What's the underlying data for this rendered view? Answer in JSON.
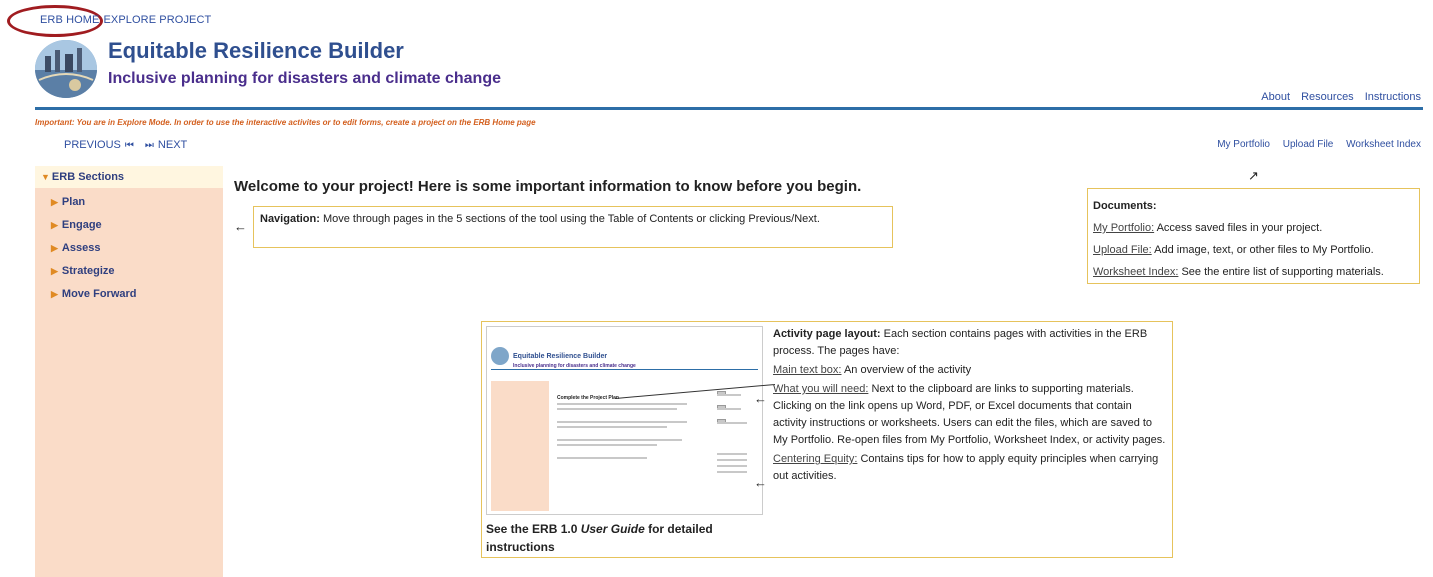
{
  "topnav": {
    "home": "ERB HOME",
    "explore": "EXPLORE PROJECT"
  },
  "header": {
    "title": "Equitable Resilience Builder",
    "subtitle": "Inclusive planning for disasters and climate change",
    "links": [
      "About",
      "Resources",
      "Instructions"
    ]
  },
  "warning": "Important: You are in Explore Mode. In order to use the interactive activites or to edit forms, create a project on the ERB Home page",
  "pager": {
    "previous": "PREVIOUS",
    "next": "NEXT"
  },
  "util_links": [
    "My Portfolio",
    "Upload File",
    "Worksheet Index"
  ],
  "sidebar": {
    "heading": "ERB Sections",
    "items": [
      "Plan",
      "Engage",
      "Assess",
      "Strategize",
      "Move Forward"
    ]
  },
  "main": {
    "welcome": "Welcome to your project! Here is some important information to know before you begin.",
    "navigation": {
      "label": "Navigation:",
      "text": "Move through pages in the 5 sections of the tool using the Table of Contents or clicking Previous/Next."
    },
    "documents": {
      "heading": "Documents:",
      "rows": [
        {
          "label": "My Portfolio:",
          "text": "Access saved files in your project."
        },
        {
          "label": "Upload File:",
          "text": "Add image, text, or other files to My Portfolio."
        },
        {
          "label": "Worksheet Index:",
          "text": "See the entire list of supporting materials."
        }
      ]
    },
    "layout": {
      "label": "Activity page layout:",
      "intro": "Each section contains pages with activities in the ERB process. The pages have:",
      "main_text_label": "Main text box:",
      "main_text": "An overview of the activity",
      "need_label": "What you will need:",
      "need_text": "Next to the clipboard are links to supporting materials. Clicking on the link opens up Word, PDF, or Excel documents that contain activity instructions or worksheets. Users can edit the files, which are saved to My Portfolio. Re-open files from My Portfolio, Worksheet Index, or activity pages.",
      "equity_label": "Centering Equity:",
      "equity_text": "Contains tips for how to apply equity principles when carrying out activities.",
      "guide_pre": "See the ERB 1.0 ",
      "guide_em": "User Guide",
      "guide_post": " for detailed instructions"
    },
    "mini": {
      "title": "Equitable Resilience Builder",
      "subtitle": "Inclusive planning for disasters and climate change",
      "page_title": "Complete the Project Plan"
    }
  },
  "colors": {
    "accent": "#2d6ea7",
    "sidebar": "#fadcc8",
    "warning": "#d35f1e",
    "box_border": "#e6c35c",
    "home_circle": "#a01c20"
  }
}
